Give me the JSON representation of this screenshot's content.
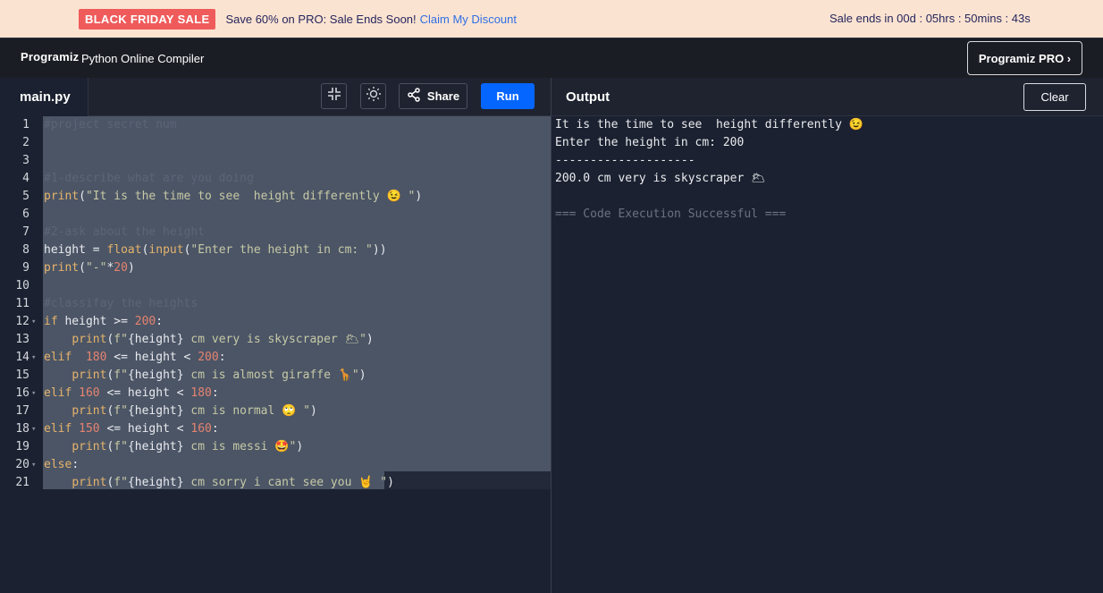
{
  "promo": {
    "badge": "BLACK FRIDAY SALE",
    "message": "Save 60% on PRO: Sale Ends Soon!",
    "link": "Claim My Discount",
    "countdown": "Sale ends in 00d : 05hrs : 50mins : 43s"
  },
  "header": {
    "logo": "Programiz",
    "title": "Python Online Compiler",
    "pro_button": "Programiz PRO ›"
  },
  "toolbar": {
    "file_tab": "main.py",
    "share_label": "Share",
    "run_label": "Run"
  },
  "output_panel": {
    "title": "Output",
    "clear_label": "Clear",
    "lines": [
      "It is the time to see  height differently 😉",
      "Enter the height in cm: 200",
      "--------------------",
      "200.0 cm very is skyscraper 🌥",
      "",
      "=== Code Execution Successful ==="
    ]
  },
  "code": {
    "line_numbers": [
      "1",
      "2",
      "3",
      "4",
      "5",
      "6",
      "7",
      "8",
      "9",
      "10",
      "11",
      "12",
      "13",
      "14",
      "15",
      "16",
      "17",
      "18",
      "19",
      "20",
      "21"
    ],
    "l1": "#project secret num",
    "l4": "#1-describe what are you doing",
    "l5_fn": "print",
    "l5_str": "\"It is the time to see  height differently 😉 \"",
    "l7": "#2-ask about the height",
    "l8_a": "height = ",
    "l8_fn1": "float",
    "l8_fn2": "input",
    "l8_str": "\"Enter the height in cm: \"",
    "l9_fn": "print",
    "l9_str": "\"-\"",
    "l9_num": "20",
    "l11": "#classifay the heights",
    "l12_kw": "if",
    "l12_var": " height >= ",
    "l12_num": "200",
    "l13_fn": "print",
    "l13_f": "f\"",
    "l13_var": "{height}",
    "l13_str": " cm very is skyscraper 🌥\"",
    "l14_kw": "elif",
    "l14_num1": "180",
    "l14_mid": " <= height < ",
    "l14_num2": "200",
    "l15_fn": "print",
    "l15_f": "f\"",
    "l15_var": "{height}",
    "l15_str": " cm is almost giraffe 🦒\"",
    "l16_kw": "elif",
    "l16_num1": "160",
    "l16_mid": " <= height < ",
    "l16_num2": "180",
    "l17_fn": "print",
    "l17_f": "f\"",
    "l17_var": "{height}",
    "l17_str": " cm is normal 🙄 \"",
    "l18_kw": "elif",
    "l18_num1": "150",
    "l18_mid": " <= height < ",
    "l18_num2": "160",
    "l19_fn": "print",
    "l19_f": "f\"",
    "l19_var": "{height}",
    "l19_str": " cm is messi 🤩\"",
    "l20_kw": "else",
    "l21_fn": "print",
    "l21_f": "f\"",
    "l21_var": "{height}",
    "l21_str": " cm sorry i cant see you 🤘 \""
  }
}
